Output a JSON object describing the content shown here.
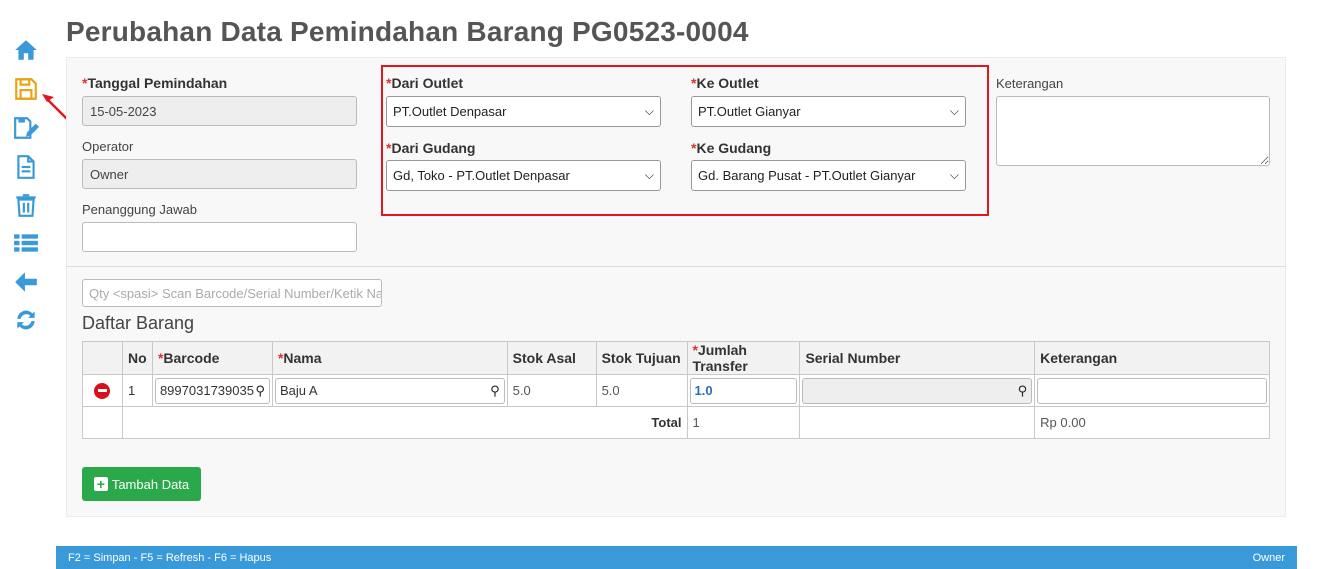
{
  "title": "Perubahan Data Pemindahan Barang PG0523-0004",
  "sidebar": {
    "items": [
      "home-icon",
      "save-icon",
      "edit-icon",
      "document-icon",
      "trash-icon",
      "list-icon",
      "back-icon",
      "refresh-icon"
    ]
  },
  "form": {
    "tanggal_label": "Tanggal Pemindahan",
    "tanggal_value": "15-05-2023",
    "operator_label": "Operator",
    "operator_value": "Owner",
    "penanggung_label": "Penanggung Jawab",
    "penanggung_value": "",
    "dari_outlet_label": "Dari Outlet",
    "dari_outlet_value": "PT.Outlet Denpasar",
    "ke_outlet_label": "Ke Outlet",
    "ke_outlet_value": "PT.Outlet Gianyar",
    "dari_gudang_label": "Dari Gudang",
    "dari_gudang_value": "Gd, Toko - PT.Outlet Denpasar",
    "ke_gudang_label": "Ke Gudang",
    "ke_gudang_value": "Gd. Barang Pusat - PT.Outlet Gianyar",
    "keterangan_label": "Keterangan",
    "keterangan_value": "",
    "required_mark": "*"
  },
  "scan": {
    "placeholder": "Qty <spasi> Scan Barcode/Serial Number/Ketik Na"
  },
  "section_title": "Daftar Barang",
  "table": {
    "headers": {
      "no": "No",
      "barcode": "Barcode",
      "nama": "Nama",
      "stok_asal": "Stok Asal",
      "stok_tujuan": "Stok Tujuan",
      "jumlah": "Jumlah Transfer",
      "serial": "Serial Number",
      "keterangan": "Keterangan"
    },
    "rows": [
      {
        "no": "1",
        "barcode": "8997031739035",
        "nama": "Baju A",
        "stok_asal": "5.0",
        "stok_tujuan": "5.0",
        "jumlah": "1.0",
        "serial": "",
        "keterangan": ""
      }
    ],
    "total_label": "Total",
    "total_qty": "1",
    "total_amount": "Rp 0.00"
  },
  "add_button": "Tambah Data",
  "footer": {
    "shortcuts": "F2 = Simpan - F5 = Refresh - F6 = Hapus",
    "user": "Owner"
  },
  "colors": {
    "sidebar_icon": "#3a9ad9",
    "save_icon": "#e8a317",
    "highlight": "#e3161d",
    "add_button": "#2aa84a",
    "footer": "#3a9ad9"
  }
}
